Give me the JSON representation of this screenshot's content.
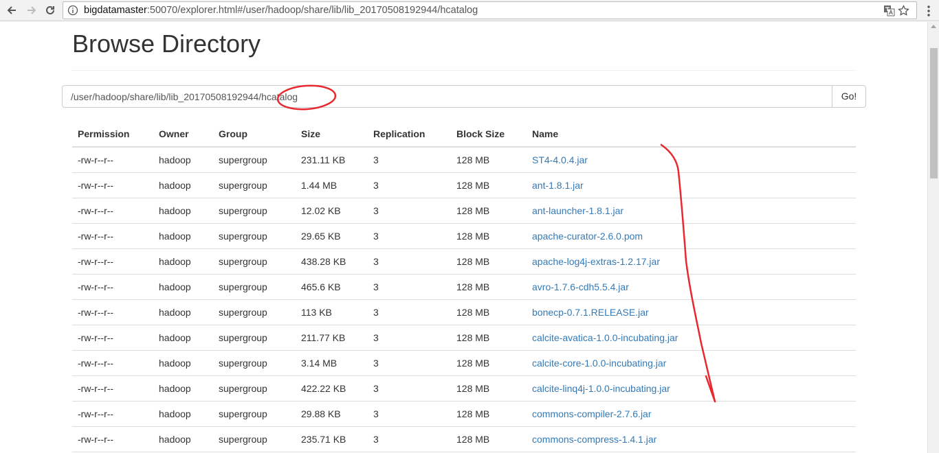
{
  "browser": {
    "url_host": "bigdatamaster",
    "url_rest": ":50070/explorer.html#/user/hadoop/share/lib/lib_20170508192944/hcatalog"
  },
  "page": {
    "title": "Browse Directory",
    "path_value": "/user/hadoop/share/lib/lib_20170508192944/hcatalog",
    "go_label": "Go!"
  },
  "table": {
    "headers": {
      "permission": "Permission",
      "owner": "Owner",
      "group": "Group",
      "size": "Size",
      "replication": "Replication",
      "block_size": "Block Size",
      "name": "Name"
    },
    "rows": [
      {
        "permission": "-rw-r--r--",
        "owner": "hadoop",
        "group": "supergroup",
        "size": "231.11 KB",
        "replication": "3",
        "block_size": "128 MB",
        "name": "ST4-4.0.4.jar"
      },
      {
        "permission": "-rw-r--r--",
        "owner": "hadoop",
        "group": "supergroup",
        "size": "1.44 MB",
        "replication": "3",
        "block_size": "128 MB",
        "name": "ant-1.8.1.jar"
      },
      {
        "permission": "-rw-r--r--",
        "owner": "hadoop",
        "group": "supergroup",
        "size": "12.02 KB",
        "replication": "3",
        "block_size": "128 MB",
        "name": "ant-launcher-1.8.1.jar"
      },
      {
        "permission": "-rw-r--r--",
        "owner": "hadoop",
        "group": "supergroup",
        "size": "29.65 KB",
        "replication": "3",
        "block_size": "128 MB",
        "name": "apache-curator-2.6.0.pom"
      },
      {
        "permission": "-rw-r--r--",
        "owner": "hadoop",
        "group": "supergroup",
        "size": "438.28 KB",
        "replication": "3",
        "block_size": "128 MB",
        "name": "apache-log4j-extras-1.2.17.jar"
      },
      {
        "permission": "-rw-r--r--",
        "owner": "hadoop",
        "group": "supergroup",
        "size": "465.6 KB",
        "replication": "3",
        "block_size": "128 MB",
        "name": "avro-1.7.6-cdh5.5.4.jar"
      },
      {
        "permission": "-rw-r--r--",
        "owner": "hadoop",
        "group": "supergroup",
        "size": "113 KB",
        "replication": "3",
        "block_size": "128 MB",
        "name": "bonecp-0.7.1.RELEASE.jar"
      },
      {
        "permission": "-rw-r--r--",
        "owner": "hadoop",
        "group": "supergroup",
        "size": "211.77 KB",
        "replication": "3",
        "block_size": "128 MB",
        "name": "calcite-avatica-1.0.0-incubating.jar"
      },
      {
        "permission": "-rw-r--r--",
        "owner": "hadoop",
        "group": "supergroup",
        "size": "3.14 MB",
        "replication": "3",
        "block_size": "128 MB",
        "name": "calcite-core-1.0.0-incubating.jar"
      },
      {
        "permission": "-rw-r--r--",
        "owner": "hadoop",
        "group": "supergroup",
        "size": "422.22 KB",
        "replication": "3",
        "block_size": "128 MB",
        "name": "calcite-linq4j-1.0.0-incubating.jar"
      },
      {
        "permission": "-rw-r--r--",
        "owner": "hadoop",
        "group": "supergroup",
        "size": "29.88 KB",
        "replication": "3",
        "block_size": "128 MB",
        "name": "commons-compiler-2.7.6.jar"
      },
      {
        "permission": "-rw-r--r--",
        "owner": "hadoop",
        "group": "supergroup",
        "size": "235.71 KB",
        "replication": "3",
        "block_size": "128 MB",
        "name": "commons-compress-1.4.1.jar"
      }
    ]
  },
  "colors": {
    "link": "#337ab7",
    "annotation": "#e8282e"
  }
}
